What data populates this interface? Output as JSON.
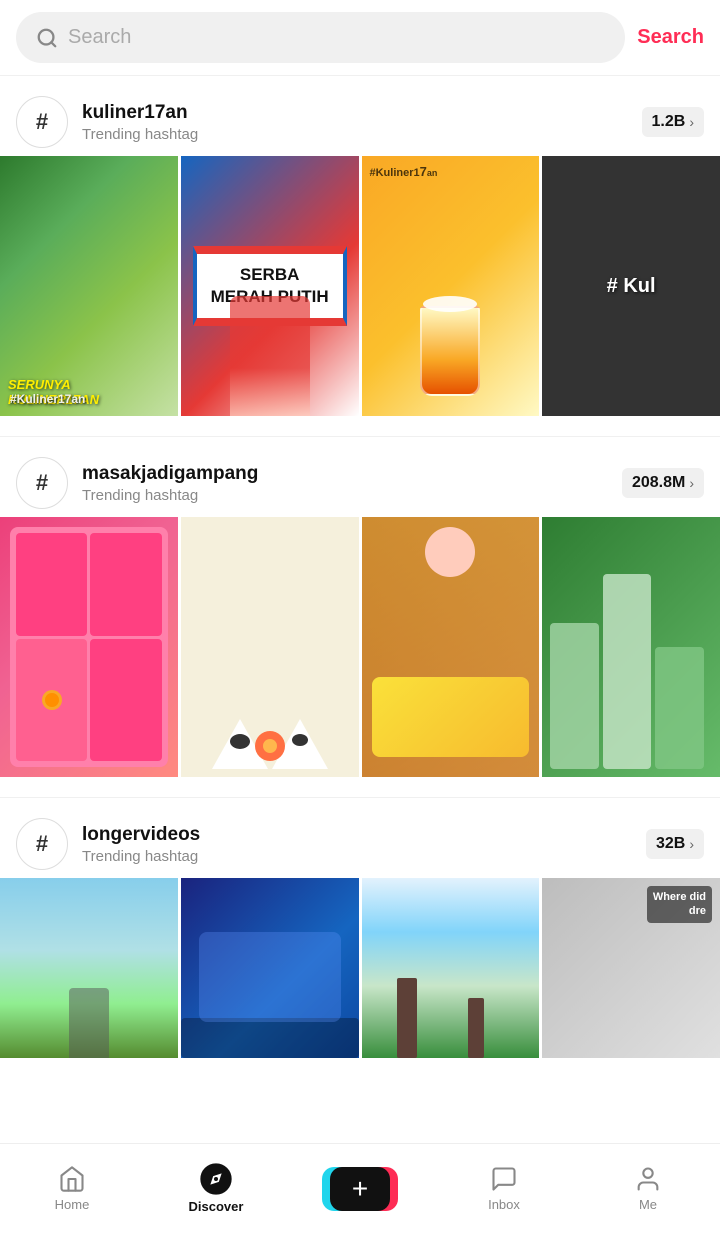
{
  "search": {
    "placeholder": "Search",
    "button_label": "Search"
  },
  "trending": [
    {
      "id": "kuliner17an",
      "name": "kuliner17an",
      "sub": "Trending hashtag",
      "count": "1.2B",
      "images": [
        {
          "id": "k1",
          "class": "food-img-person",
          "overlay": "SERUNYA\nKULINER17AN",
          "hashtag": "#Kuliner17an"
        },
        {
          "id": "k2",
          "class": "img-food2",
          "overlay_box": "SERBA\nMERAH PUTIH"
        },
        {
          "id": "k3",
          "class": "img-food3",
          "hashtag": "#Kuliner17an"
        },
        {
          "id": "k4",
          "class": "img-food4",
          "partial": "# Kul"
        }
      ]
    },
    {
      "id": "masakjadigampang",
      "name": "masakjadigampang",
      "sub": "Trending hashtag",
      "count": "208.8M",
      "images": [
        {
          "id": "m1",
          "class": "img-bento1"
        },
        {
          "id": "m2",
          "class": "img-bento2"
        },
        {
          "id": "m3",
          "class": "img-bento3"
        },
        {
          "id": "m4",
          "class": "img-bento4"
        }
      ]
    },
    {
      "id": "longervideos",
      "name": "longervideos",
      "sub": "Trending hashtag",
      "count": "32B",
      "images": [
        {
          "id": "l1",
          "class": "img-long1"
        },
        {
          "id": "l2",
          "class": "img-long2"
        },
        {
          "id": "l3",
          "class": "img-long3"
        },
        {
          "id": "l4",
          "class": "img-long4",
          "where": "Where did\ndre"
        }
      ]
    }
  ],
  "nav": {
    "items": [
      {
        "id": "home",
        "label": "Home",
        "icon": "🏠",
        "active": false
      },
      {
        "id": "discover",
        "label": "Discover",
        "icon": "discover",
        "active": true
      },
      {
        "id": "add",
        "label": "",
        "icon": "+",
        "active": false
      },
      {
        "id": "inbox",
        "label": "Inbox",
        "icon": "💬",
        "active": false
      },
      {
        "id": "me",
        "label": "Me",
        "icon": "👤",
        "active": false
      }
    ]
  }
}
